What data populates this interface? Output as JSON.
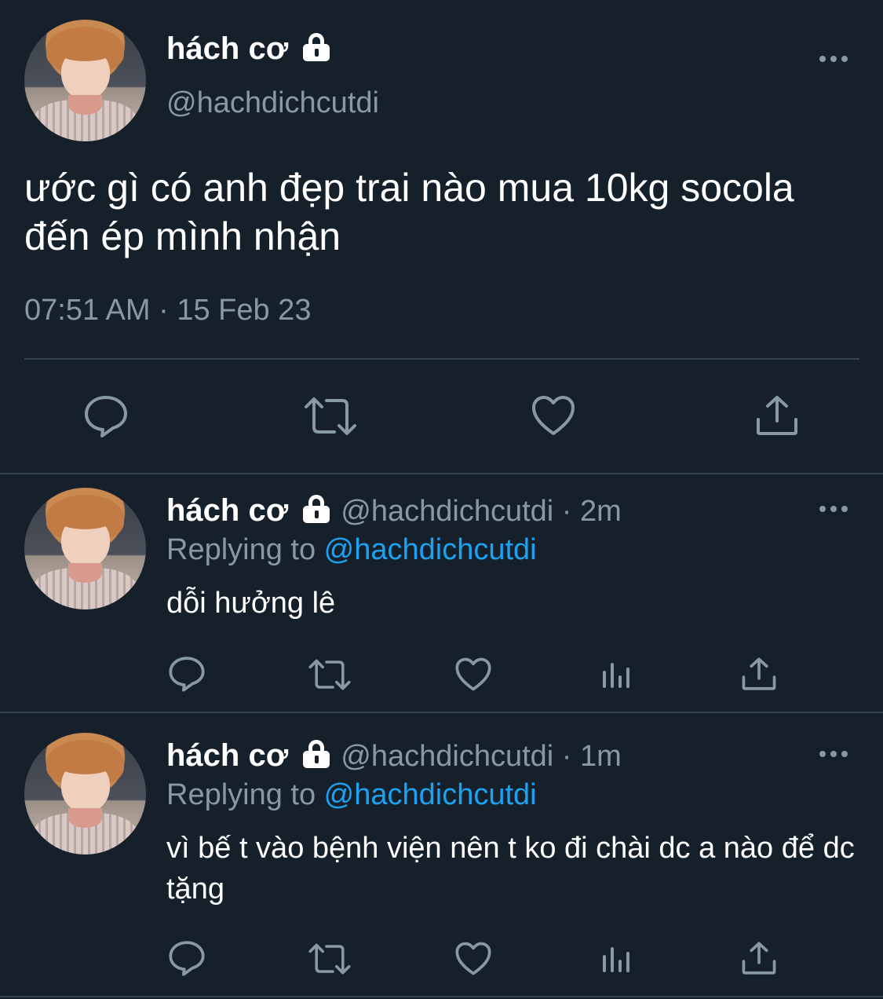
{
  "tweet": {
    "name": "hách cơ",
    "handle": "@hachdichcutdi",
    "text": "ước gì có anh đẹp trai nào mua 10kg socola đến ép mình nhận",
    "timestamp": "07:51 AM · 15 Feb 23",
    "actions": [
      "reply-icon",
      "retweet-icon",
      "like-icon",
      "share-icon"
    ]
  },
  "replies": [
    {
      "name": "hách cơ",
      "handle_time": "@hachdichcutdi · 2m",
      "replying_prefix": "Replying to ",
      "replying_mention": "@hachdichcutdi",
      "text": "dỗi hưởng lê",
      "actions": [
        "reply-icon",
        "retweet-icon",
        "like-icon",
        "analytics-icon",
        "share-icon"
      ]
    },
    {
      "name": "hách cơ",
      "handle_time": "@hachdichcutdi · 1m",
      "replying_prefix": "Replying to ",
      "replying_mention": "@hachdichcutdi",
      "text": "vì bế t vào bệnh viện nên t ko đi chài dc a nào để dc tặng",
      "actions": [
        "reply-icon",
        "retweet-icon",
        "like-icon",
        "analytics-icon",
        "share-icon"
      ]
    }
  ],
  "colors": {
    "background": "#15202b",
    "secondary_text": "#8899a6",
    "mention": "#1da1f2",
    "divider": "#38444d"
  }
}
